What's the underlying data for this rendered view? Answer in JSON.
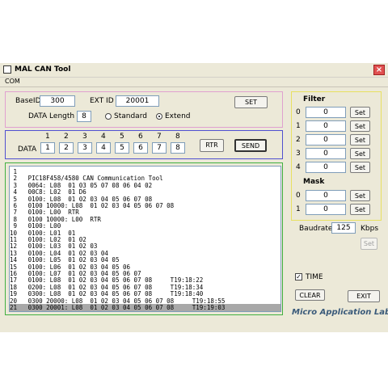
{
  "window": {
    "title": "MAL CAN Tool",
    "close_glyph": "×"
  },
  "menu": {
    "items": [
      "COM"
    ]
  },
  "config": {
    "baseid_label": "BaseID",
    "baseid_value": "300",
    "extid_label": "EXT ID",
    "extid_value": "20001",
    "set_label": "SET",
    "datalen_label": "DATA Length",
    "datalen_value": "8",
    "standard_label": "Standard",
    "extend_label": "Extend",
    "frame_format": "Extend"
  },
  "data_row": {
    "label": "DATA",
    "indices": [
      "1",
      "2",
      "3",
      "4",
      "5",
      "6",
      "7",
      "8"
    ],
    "values": [
      "1",
      "2",
      "3",
      "4",
      "5",
      "6",
      "7",
      "8"
    ],
    "rtr_label": "RTR",
    "send_label": "SEND"
  },
  "filter": {
    "title": "Filter",
    "rows": [
      {
        "index": "0",
        "value": "0",
        "button": "Set"
      },
      {
        "index": "1",
        "value": "0",
        "button": "Set"
      },
      {
        "index": "2",
        "value": "0",
        "button": "Set"
      },
      {
        "index": "3",
        "value": "0",
        "button": "Set"
      },
      {
        "index": "4",
        "value": "0",
        "button": "Set"
      }
    ]
  },
  "mask": {
    "title": "Mask",
    "rows": [
      {
        "index": "0",
        "value": "0",
        "button": "Set"
      },
      {
        "index": "1",
        "value": "0",
        "button": "Set"
      }
    ]
  },
  "baudrate": {
    "label": "Baudrate",
    "value": "125",
    "unit": "Kbps",
    "set_label": "Set"
  },
  "time": {
    "label": "TIME",
    "checked": true,
    "check_glyph": "✓"
  },
  "actions": {
    "clear_label": "CLEAR",
    "exit_label": "EXIT"
  },
  "brand": "Micro Application Lab",
  "log": [
    " 1",
    " 2   PIC18F458/4580 CAN Communication Tool",
    " 3   0064: L08  01 03 05 07 08 06 04 02",
    " 4   00C8: L02  01 D6",
    " 5   0100: L08  01 02 03 04 05 06 07 08",
    " 6   0100 10000: L08  01 02 03 04 05 06 07 08",
    " 7   0100: L00  RTR",
    " 8   0100 10000: L00  RTR",
    " 9   0100: L00",
    "10   0100: L01  01",
    "11   0100: L02  01 02",
    "12   0100: L03  01 02 03",
    "13   0100: L04  01 02 03 04",
    "14   0100: L05  01 02 03 04 05",
    "15   0100: L06  01 02 03 04 05 06",
    "16   0100: L07  01 02 03 04 05 06 07",
    "17   0100: L08  01 02 03 04 05 06 07 08     T19:18:22",
    "18   0200: L08  01 02 03 04 05 06 07 08     T19:18:34",
    "19   0300: L08  01 02 03 04 05 06 07 08     T19:18:40",
    "20   0300 20000: L08  01 02 03 04 05 06 07 08     T19:18:55",
    "21   0300 20001: L08  01 02 03 04 05 06 07 08     T19:19:03"
  ],
  "selected_log_line": 21,
  "colors": {
    "config_border": "#e0a0d0",
    "data_border": "#5050d0",
    "log_border": "#40b040",
    "filter_border": "#e8e060"
  }
}
